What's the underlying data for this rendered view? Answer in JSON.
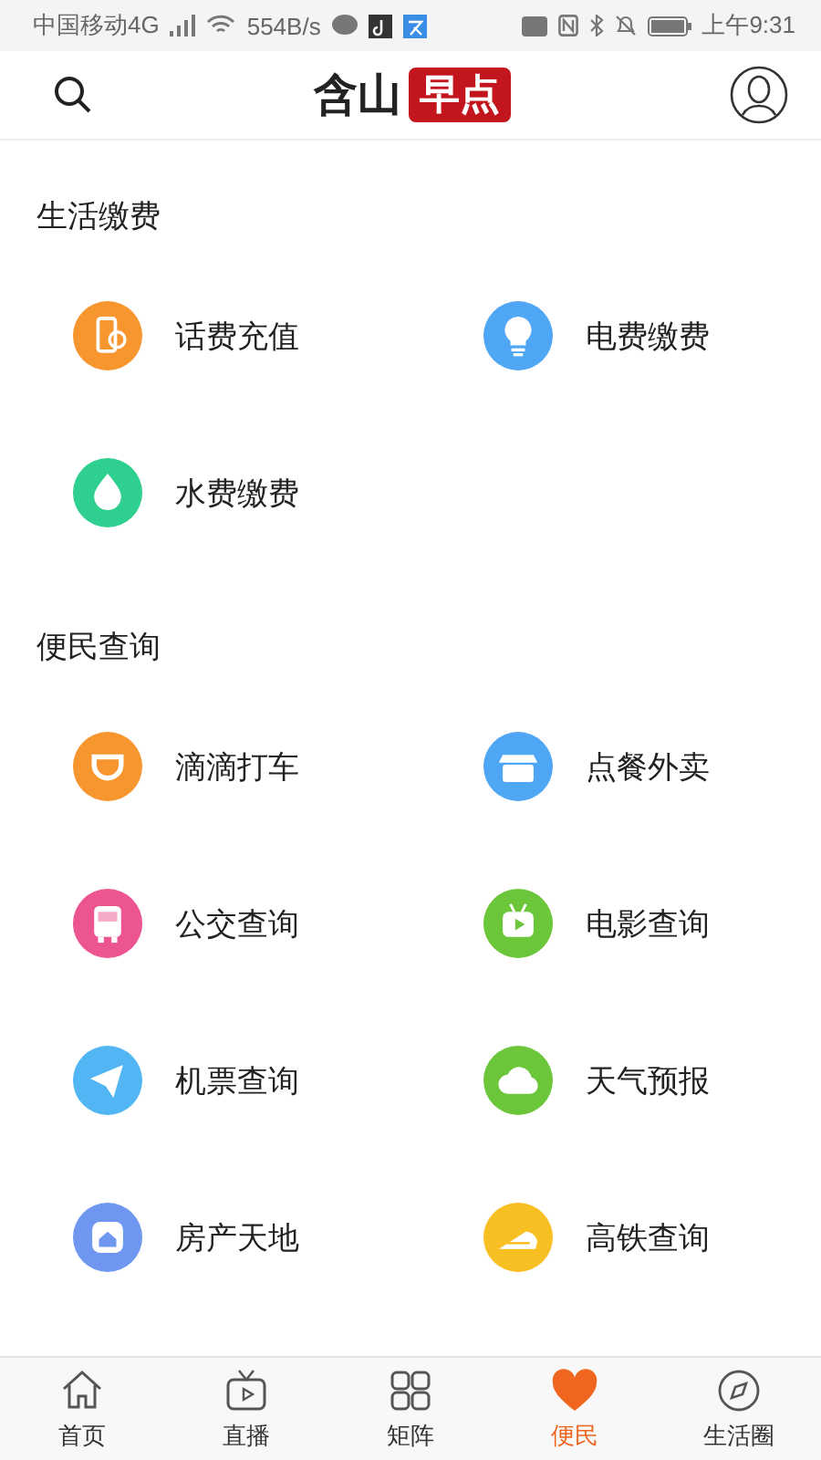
{
  "status_bar": {
    "carrier": "中国移动4G",
    "speed": "554B/s",
    "time": "上午9:31"
  },
  "header": {
    "logo_plain": "含山",
    "logo_badge": "早点"
  },
  "sections": [
    {
      "title": "生活缴费",
      "items": [
        {
          "label": "话费充值",
          "kind": "phone",
          "color": "#f7952f"
        },
        {
          "label": "电费缴费",
          "kind": "bulb",
          "color": "#4fa6f4"
        },
        {
          "label": "水费缴费",
          "kind": "drop",
          "color": "#2fcf8f"
        }
      ]
    },
    {
      "title": "便民查询",
      "items": [
        {
          "label": "滴滴打车",
          "kind": "taxi",
          "color": "#f7952f"
        },
        {
          "label": "点餐外卖",
          "kind": "box",
          "color": "#4fa6f4"
        },
        {
          "label": "公交查询",
          "kind": "bus",
          "color": "#ec5590"
        },
        {
          "label": "电影查询",
          "kind": "tv",
          "color": "#6cc63a"
        },
        {
          "label": "机票查询",
          "kind": "plane",
          "color": "#52b6f5"
        },
        {
          "label": "天气预报",
          "kind": "cloud",
          "color": "#6cc63a"
        },
        {
          "label": "房产天地",
          "kind": "house",
          "color": "#6f97f0"
        },
        {
          "label": "高铁查询",
          "kind": "train",
          "color": "#f8bf22"
        }
      ]
    }
  ],
  "tabs": [
    {
      "label": "首页",
      "kind": "home",
      "selected": false
    },
    {
      "label": "直播",
      "kind": "tv",
      "selected": false
    },
    {
      "label": "矩阵",
      "kind": "grid",
      "selected": false
    },
    {
      "label": "便民",
      "kind": "heart",
      "selected": true
    },
    {
      "label": "生活圈",
      "kind": "compass",
      "selected": false
    }
  ]
}
